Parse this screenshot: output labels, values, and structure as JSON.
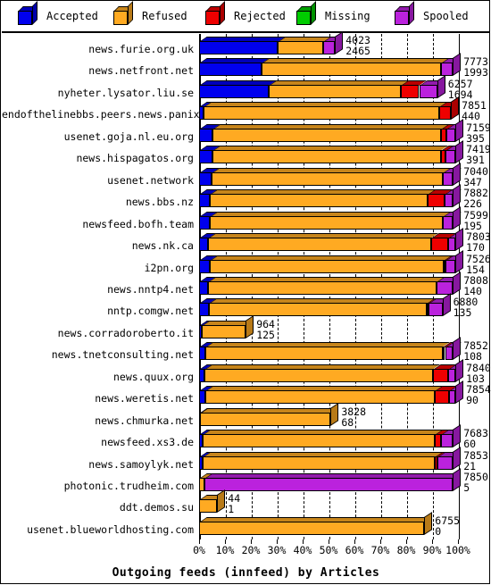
{
  "chart_data": {
    "type": "bar",
    "orientation": "horizontal",
    "stacked": true,
    "title": "Outgoing feeds (innfeed) by Articles",
    "xlabel": "Outgoing feeds (innfeed) by Articles",
    "ylabel": "",
    "xlim": [
      0,
      100
    ],
    "x_unit": "%",
    "grid": true,
    "legend_position": "top",
    "xticks": [
      "0%",
      "10%",
      "20%",
      "30%",
      "40%",
      "50%",
      "60%",
      "70%",
      "80%",
      "90%",
      "100%"
    ],
    "xtick_values": [
      0,
      10,
      20,
      30,
      40,
      50,
      60,
      70,
      80,
      90,
      100
    ],
    "legend": [
      {
        "name": "Accepted",
        "color": "#0000ee"
      },
      {
        "name": "Refused",
        "color": "#ffaa22"
      },
      {
        "name": "Rejected",
        "color": "#ee0000"
      },
      {
        "name": "Missing",
        "color": "#00cc00"
      },
      {
        "name": "Spooled",
        "color": "#bb22dd"
      }
    ],
    "series": [
      {
        "name": "Accepted",
        "color": "#0000ee",
        "values": [
          30.5,
          24.0,
          27.0,
          1.8,
          5.0,
          5.3,
          4.8,
          4.2,
          4.0,
          3.6,
          4.0,
          3.3,
          3.8,
          1.0,
          2.5,
          2.2,
          2.4,
          0.3,
          1.3,
          1.4,
          0.0,
          0.0,
          0.0
        ]
      },
      {
        "name": "Refused",
        "color": "#ffaa22",
        "values": [
          17.5,
          69.5,
          51.0,
          91.0,
          88.5,
          88.0,
          89.2,
          84.0,
          90.0,
          86.0,
          90.5,
          88.5,
          84.0,
          17.0,
          91.5,
          88.0,
          88.5,
          50.5,
          89.7,
          89.6,
          2.0,
          7.0,
          87.0
        ]
      },
      {
        "name": "Rejected",
        "color": "#ee0000",
        "values": [
          0.0,
          0.0,
          7.0,
          4.5,
          2.0,
          2.0,
          0.0,
          6.5,
          0.0,
          6.5,
          0.8,
          0.0,
          0.8,
          0.0,
          1.0,
          6.0,
          5.8,
          0.0,
          2.5,
          1.0,
          0.0,
          0.0,
          0.0
        ]
      },
      {
        "name": "Missing",
        "color": "#00cc00",
        "values": [
          0,
          0,
          0,
          0,
          0,
          0,
          0,
          0,
          0,
          0,
          0,
          0,
          0,
          0,
          0,
          0,
          0,
          0,
          0,
          0,
          0,
          0,
          0
        ]
      },
      {
        "name": "Spooled",
        "color": "#bb22dd",
        "values": [
          4.5,
          4.5,
          7.0,
          0.0,
          3.5,
          3.7,
          4.0,
          3.3,
          4.0,
          2.9,
          3.7,
          6.2,
          5.4,
          0.0,
          3.0,
          2.8,
          2.3,
          0.0,
          4.5,
          6.0,
          96.0,
          0.0,
          0.0
        ]
      }
    ],
    "categories": [
      "news.furie.org.uk",
      "news.netfront.net",
      "nyheter.lysator.liu.se",
      "endofthelinebbs.peers.news.panix.com",
      "usenet.goja.nl.eu.org",
      "news.hispagatos.org",
      "usenet.network",
      "news.bbs.nz",
      "newsfeed.bofh.team",
      "news.nk.ca",
      "i2pn.org",
      "news.nntp4.net",
      "nntp.comgw.net",
      "news.corradoroberto.it",
      "news.tnetconsulting.net",
      "news.quux.org",
      "news.weretis.net",
      "news.chmurka.net",
      "newsfeed.xs3.de",
      "news.samoylyk.net",
      "photonic.trudheim.com",
      "ddt.demos.su",
      "usenet.blueworldhosting.com"
    ],
    "rows": [
      {
        "label": "news.furie.org.uk",
        "top_value": "4023",
        "bottom_value": "2465",
        "total_pct": 52.5
      },
      {
        "label": "news.netfront.net",
        "top_value": "7773",
        "bottom_value": "1993",
        "total_pct": 98.0
      },
      {
        "label": "nyheter.lysator.liu.se",
        "top_value": "6257",
        "bottom_value": "1694",
        "total_pct": 92.0
      },
      {
        "label": "endofthelinebbs.peers.news.panix.com",
        "top_value": "7851",
        "bottom_value": "440",
        "total_pct": 97.3
      },
      {
        "label": "usenet.goja.nl.eu.org",
        "top_value": "7159",
        "bottom_value": "395",
        "total_pct": 99.0
      },
      {
        "label": "news.hispagatos.org",
        "top_value": "7419",
        "bottom_value": "391",
        "total_pct": 99.0
      },
      {
        "label": "usenet.network",
        "top_value": "7040",
        "bottom_value": "347",
        "total_pct": 98.0
      },
      {
        "label": "news.bbs.nz",
        "top_value": "7882",
        "bottom_value": "226",
        "total_pct": 98.0
      },
      {
        "label": "newsfeed.bofh.team",
        "top_value": "7599",
        "bottom_value": "195",
        "total_pct": 98.0
      },
      {
        "label": "news.nk.ca",
        "top_value": "7803",
        "bottom_value": "170",
        "total_pct": 99.0
      },
      {
        "label": "i2pn.org",
        "top_value": "7526",
        "bottom_value": "154",
        "total_pct": 99.0
      },
      {
        "label": "news.nntp4.net",
        "top_value": "7808",
        "bottom_value": "140",
        "total_pct": 98.0
      },
      {
        "label": "nntp.comgw.net",
        "top_value": "6880",
        "bottom_value": "135",
        "total_pct": 94.0
      },
      {
        "label": "news.corradoroberto.it",
        "top_value": "964",
        "bottom_value": "125",
        "total_pct": 18.0
      },
      {
        "label": "news.tnetconsulting.net",
        "top_value": "7852",
        "bottom_value": "108",
        "total_pct": 98.0
      },
      {
        "label": "news.quux.org",
        "top_value": "7840",
        "bottom_value": "103",
        "total_pct": 99.0
      },
      {
        "label": "news.weretis.net",
        "top_value": "7854",
        "bottom_value": "90",
        "total_pct": 99.0
      },
      {
        "label": "news.chmurka.net",
        "top_value": "3828",
        "bottom_value": "68",
        "total_pct": 50.8
      },
      {
        "label": "newsfeed.xs3.de",
        "top_value": "7683",
        "bottom_value": "60",
        "total_pct": 98.0
      },
      {
        "label": "news.samoylyk.net",
        "top_value": "7853",
        "bottom_value": "21",
        "total_pct": 98.0
      },
      {
        "label": "photonic.trudheim.com",
        "top_value": "7850",
        "bottom_value": "5",
        "total_pct": 98.0
      },
      {
        "label": "ddt.demos.su",
        "top_value": "44",
        "bottom_value": "1",
        "total_pct": 7.0
      },
      {
        "label": "usenet.blueworldhosting.com",
        "top_value": "6755",
        "bottom_value": "0",
        "total_pct": 87.0
      }
    ]
  }
}
